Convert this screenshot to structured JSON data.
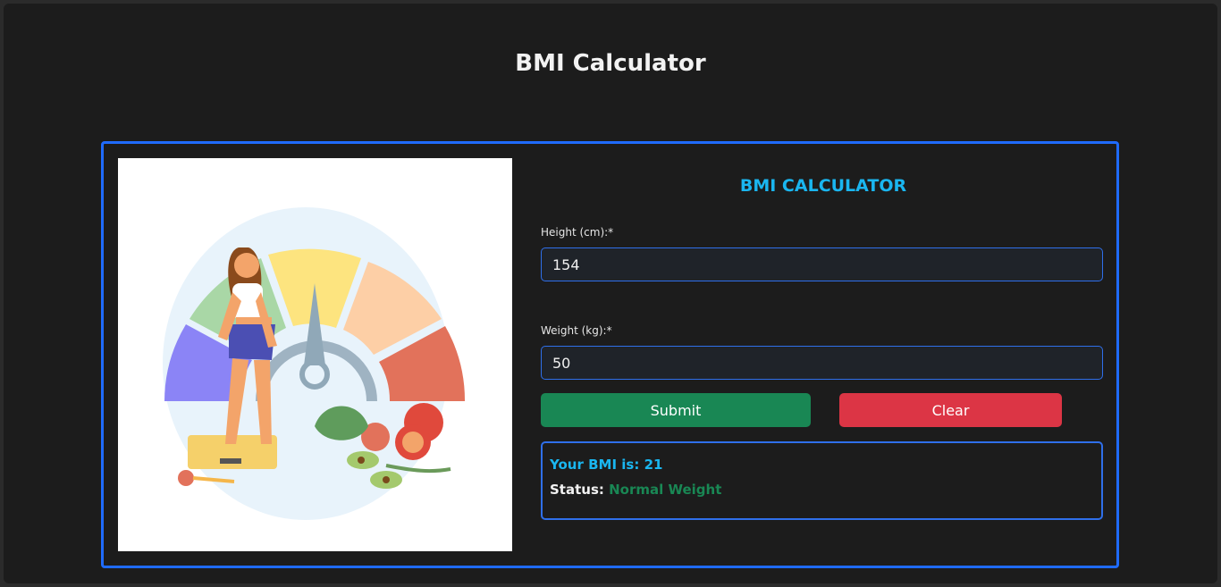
{
  "page": {
    "title": "BMI Calculator"
  },
  "form": {
    "title": "BMI CALCULATOR",
    "height": {
      "label": "Height (cm):*",
      "value": "154"
    },
    "weight": {
      "label": "Weight (kg):*",
      "value": "50"
    },
    "submit_label": "Submit",
    "clear_label": "Clear"
  },
  "result": {
    "bmi_label": "Your BMI is:",
    "bmi_value": "21",
    "status_label": "Status:",
    "status_value": "Normal Weight"
  },
  "illustration": {
    "icon": "bmi-gauge-illustration",
    "colors": {
      "purple": "#8b84f6",
      "green": "#a9d7a6",
      "yellow": "#fde47f",
      "peach": "#fdcfa6",
      "red": "#e2725b"
    }
  },
  "colors": {
    "accent_border": "#1f6bff",
    "title_cyan": "#1ab6f0",
    "submit": "#198754",
    "clear": "#dc3545",
    "status_ok": "#198754"
  }
}
